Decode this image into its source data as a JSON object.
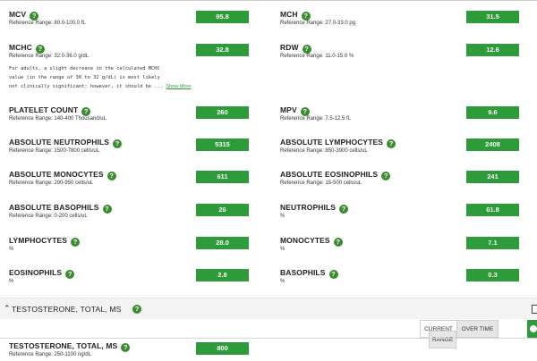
{
  "colors": {
    "value_green": "#2e9b3a",
    "help_green": "#3a8b2f",
    "section_bg": "#f3f3f3"
  },
  "icons": {
    "help": "question-circle-icon",
    "collapse": "chevron-up-icon"
  },
  "help_glyph": "?",
  "results": {
    "mcv": {
      "name": "MCV",
      "range": "Reference Range: 80.0-100.0 fL",
      "value": "95.8"
    },
    "mch": {
      "name": "MCH",
      "range": "Reference Range: 27.0-33.0 pg",
      "value": "31.5"
    },
    "mchc": {
      "name": "MCHC",
      "range": "Reference Range: 32.0-36.0 g/dL",
      "value": "32.8"
    },
    "rdw": {
      "name": "RDW",
      "range": "Reference Range: 11.0-15.0 %",
      "value": "12.6"
    },
    "platelet": {
      "name": "PLATELET COUNT",
      "range": "Reference Range: 140-400 Thousand/uL",
      "value": "260"
    },
    "mpv": {
      "name": "MPV",
      "range": "Reference Range: 7.5-12.5 fL",
      "value": "9.6"
    },
    "abs_neut": {
      "name": "ABSOLUTE NEUTROPHILS",
      "range": "Reference Range: 1500-7800 cells/uL",
      "value": "5315"
    },
    "abs_lymph": {
      "name": "ABSOLUTE LYMPHOCYTES",
      "range": "Reference Range: 850-3900 cells/uL",
      "value": "2408"
    },
    "abs_mono": {
      "name": "ABSOLUTE MONOCYTES",
      "range": "Reference Range: 200-950 cells/uL",
      "value": "611"
    },
    "abs_eos": {
      "name": "ABSOLUTE EOSINOPHILS",
      "range": "Reference Range: 15-500 cells/uL",
      "value": "241"
    },
    "abs_baso": {
      "name": "ABSOLUTE BASOPHILS",
      "range": "Reference Range: 0-200 cells/uL",
      "value": "26"
    },
    "neutrophils": {
      "name": "NEUTROPHILS",
      "range": "%",
      "value": "61.8"
    },
    "lymphocytes": {
      "name": "LYMPHOCYTES",
      "range": "%",
      "value": "28.0"
    },
    "monocytes": {
      "name": "MONOCYTES",
      "range": "%",
      "value": "7.1"
    },
    "eosinophils": {
      "name": "EOSINOPHILS",
      "range": "%",
      "value": "2.8"
    },
    "basophils": {
      "name": "BASOPHILS",
      "range": "%",
      "value": "0.3"
    },
    "testosterone": {
      "name": "TESTOSTERONE, TOTAL, MS",
      "range": "Reference Range: 250-1100 ng/dL",
      "value": "800"
    }
  },
  "mchc_note": {
    "line1": "For adults, a slight decrease in the calculated MCHC",
    "line2": "value (in the range of 30 to 32 g/dL) is most likely",
    "line3": "not clinically significant; however, it should be  ...",
    "show_more": "Show More"
  },
  "section": {
    "title": "TESTOSTERONE, TOTAL, MS"
  },
  "tabs": {
    "current": "CURRENT",
    "range": "RANGE",
    "over_time": "OVER TIME"
  }
}
